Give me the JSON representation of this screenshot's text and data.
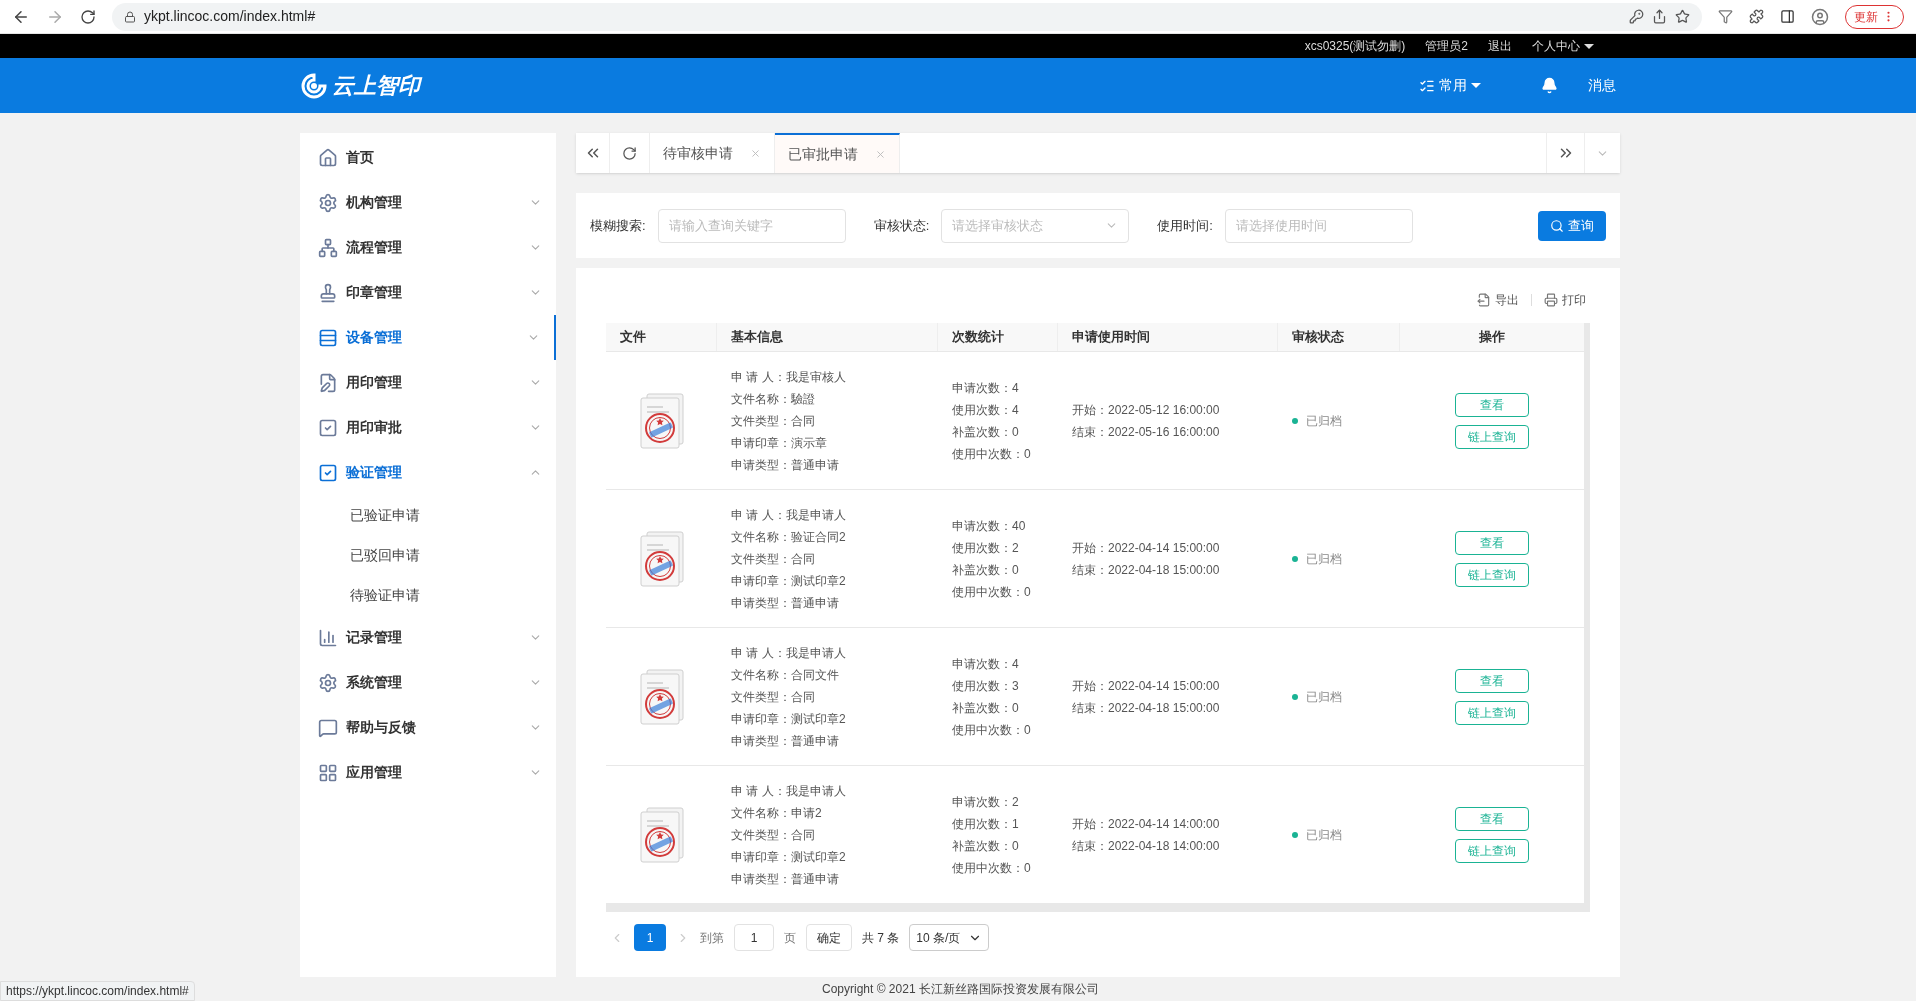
{
  "browser": {
    "url": "ykpt.lincoc.com/index.html#",
    "update_button": "更新"
  },
  "topbar": {
    "user": "xcs0325(测试勿删)",
    "role": "管理员2",
    "logout": "退出",
    "personal_center": "个人中心"
  },
  "header": {
    "logo_text": "云上智印",
    "common_menu": "常用",
    "messages": "消息"
  },
  "sidebar": {
    "items": [
      {
        "label": "首页",
        "kind": "link",
        "selected": false
      },
      {
        "label": "机构管理",
        "kind": "menu",
        "selected": false,
        "expanded": false
      },
      {
        "label": "流程管理",
        "kind": "menu",
        "selected": false,
        "expanded": false
      },
      {
        "label": "印章管理",
        "kind": "menu",
        "selected": false,
        "expanded": false
      },
      {
        "label": "设备管理",
        "kind": "menu",
        "selected": true,
        "expanded": false
      },
      {
        "label": "用印管理",
        "kind": "menu",
        "selected": false,
        "expanded": false
      },
      {
        "label": "用印审批",
        "kind": "menu",
        "selected": false,
        "expanded": false
      },
      {
        "label": "验证管理",
        "kind": "menu",
        "selected": false,
        "expanded": true,
        "children": [
          {
            "label": "已验证申请",
            "selected": false
          },
          {
            "label": "已驳回申请",
            "selected": false
          },
          {
            "label": "待验证申请",
            "selected": false
          }
        ]
      },
      {
        "label": "记录管理",
        "kind": "menu",
        "selected": false,
        "expanded": false
      },
      {
        "label": "系统管理",
        "kind": "menu",
        "selected": false,
        "expanded": false
      },
      {
        "label": "帮助与反馈",
        "kind": "menu",
        "selected": false,
        "expanded": false
      },
      {
        "label": "应用管理",
        "kind": "menu",
        "selected": false,
        "expanded": false
      }
    ]
  },
  "tabs": [
    {
      "label": "待审核申请",
      "selected": false
    },
    {
      "label": "已审批申请",
      "selected": true
    }
  ],
  "filters": [
    {
      "label": "模糊搜索:",
      "placeholder": "请输入查询关键字",
      "kind": "text"
    },
    {
      "label": "审核状态:",
      "placeholder": "请选择审核状态",
      "kind": "select"
    },
    {
      "label": "使用时间:",
      "placeholder": "请选择使用时间",
      "kind": "text"
    }
  ],
  "query_button": "查询",
  "toolbar": {
    "export": "导出",
    "print": "打印"
  },
  "table": {
    "columns": [
      "文件",
      "基本信息",
      "次数统计",
      "申请使用时间",
      "审核状态",
      "操作"
    ],
    "rows": [
      {
        "info": [
          "申 请 人：我是审核人",
          "文件名称：驗證",
          "文件类型：合同",
          "申请印章：演示章",
          "申请类型：普通申请"
        ],
        "counts": [
          "申请次数：4",
          "使用次数：4",
          "补盖次数：0",
          "使用中次数：0"
        ],
        "times": [
          "开始：2022-05-12 16:00:00",
          "结束：2022-05-16 16:00:00"
        ],
        "status": "已归档",
        "actions": [
          "查看",
          "链上查询"
        ]
      },
      {
        "info": [
          "申 请 人：我是申请人",
          "文件名称：验证合同2",
          "文件类型：合同",
          "申请印章：测试印章2",
          "申请类型：普通申请"
        ],
        "counts": [
          "申请次数：40",
          "使用次数：2",
          "补盖次数：0",
          "使用中次数：0"
        ],
        "times": [
          "开始：2022-04-14 15:00:00",
          "结束：2022-04-18 15:00:00"
        ],
        "status": "已归档",
        "actions": [
          "查看",
          "链上查询"
        ]
      },
      {
        "info": [
          "申 请 人：我是申请人",
          "文件名称：合同文件",
          "文件类型：合同",
          "申请印章：测试印章2",
          "申请类型：普通申请"
        ],
        "counts": [
          "申请次数：4",
          "使用次数：3",
          "补盖次数：0",
          "使用中次数：0"
        ],
        "times": [
          "开始：2022-04-14 15:00:00",
          "结束：2022-04-18 15:00:00"
        ],
        "status": "已归档",
        "actions": [
          "查看",
          "链上查询"
        ]
      },
      {
        "info": [
          "申 请 人：我是申请人",
          "文件名称：申请2",
          "文件类型：合同",
          "申请印章：测试印章2",
          "申请类型：普通申请"
        ],
        "counts": [
          "申请次数：2",
          "使用次数：1",
          "补盖次数：0",
          "使用中次数：0"
        ],
        "times": [
          "开始：2022-04-14 14:00:00",
          "结束：2022-04-18 14:00:00"
        ],
        "status": "已归档",
        "actions": [
          "查看",
          "链上查询"
        ]
      }
    ]
  },
  "pagination": {
    "current": "1",
    "goto_label": "到第",
    "page_input": "1",
    "page_suffix": "页",
    "confirm": "确定",
    "total": "共 7 条",
    "page_size": "10 条/页"
  },
  "footer": "Copyright © 2021 长江新丝路国际投资发展有限公司",
  "status_url": "https://ykpt.lincoc.com/index.html#"
}
